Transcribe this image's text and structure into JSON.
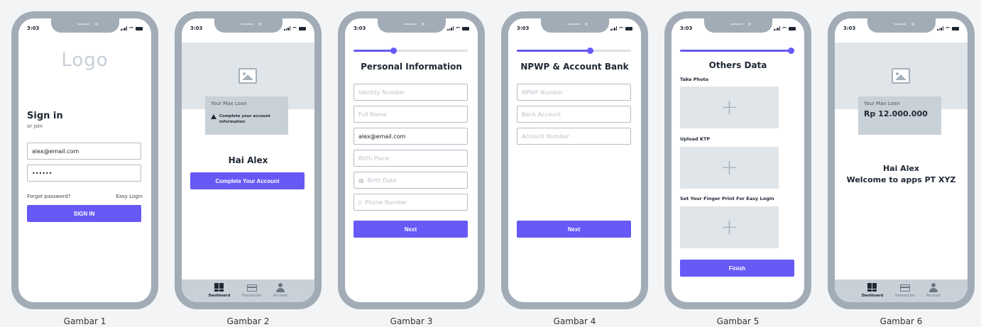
{
  "status_time": "3:03",
  "captions": [
    "Gambar 1",
    "Gambar 2",
    "Gambar 3",
    "Gambar 4",
    "Gambar 5",
    "Gambar 6"
  ],
  "screen1": {
    "logo": "Logo",
    "title": "Sign in",
    "subtitle": "or join",
    "email_value": "alex@email.com",
    "password_value": "••••••",
    "forgot": "Forgot password?",
    "easy_login": "Easy Login",
    "signin_button": "SIGN IN"
  },
  "screen2": {
    "loan_label": "Your Max Loan",
    "warning": "Complete your account information",
    "greeting": "Hai Alex",
    "button": "Complete Your Account"
  },
  "tabbar": {
    "dashboard": "Dashboard",
    "transaction": "Transaction",
    "account": "Account"
  },
  "screen3": {
    "progress": 0.35,
    "title": "Personal Information",
    "fields": {
      "identity": "Identity Number",
      "fullname": "Full Name",
      "email": "alex@email.com",
      "birthplace": "Birth Place",
      "birthdate": "Birth Date",
      "phone": "Phone Number"
    },
    "button": "Next"
  },
  "screen4": {
    "progress": 0.64,
    "title": "NPWP & Account Bank",
    "fields": {
      "npwp": "NPWP Number",
      "bank": "Bank Account",
      "account": "Account Number"
    },
    "button": "Next"
  },
  "screen5": {
    "progress": 1.0,
    "title": "Others Data",
    "take_photo": "Take Photo",
    "upload_ktp": "Upload KTP",
    "fingerprint": "Set Your Finger Print For Easy Login",
    "button": "Finish"
  },
  "screen6": {
    "loan_label": "Your Max Loan",
    "loan_amount": "Rp 12.000.000",
    "greeting": "Hai Alex",
    "welcome": "Welcome to apps PT XYZ"
  },
  "colors": {
    "primary": "#6659f6",
    "frame": "#a1acb6",
    "placeholder_bg": "#e0e5ea",
    "card": "#c9d1d8"
  }
}
